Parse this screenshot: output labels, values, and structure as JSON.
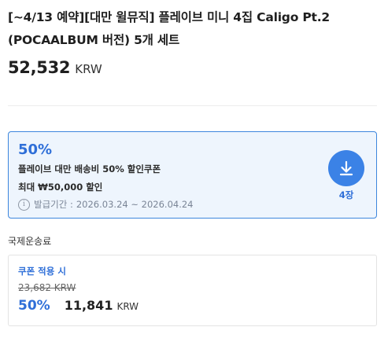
{
  "product": {
    "title": "[~4/13 예약][대만 윌뮤직] 플레이브 미니 4집 Caligo Pt.2 (POCAALBUM 버전) 5개 세트",
    "price": "52,532",
    "currency": "KRW"
  },
  "coupon": {
    "discount": "50%",
    "name": "플레이브 대만 배송비 50% 할인쿠폰",
    "max": "최대 ₩50,000 할인",
    "period_label": "발급기간 :",
    "period_value": "2026.03.24 ~ 2026.04.24",
    "info_icon": "i",
    "download_icon": "download-arrow-icon",
    "count": "4장",
    "accent_color": "#2f6fd8"
  },
  "shipping": {
    "label": "국제운송료",
    "applied_label": "쿠폰 적용 시",
    "original": "23,682 KRW",
    "discount": "50%",
    "final_price": "11,841",
    "currency": "KRW"
  }
}
